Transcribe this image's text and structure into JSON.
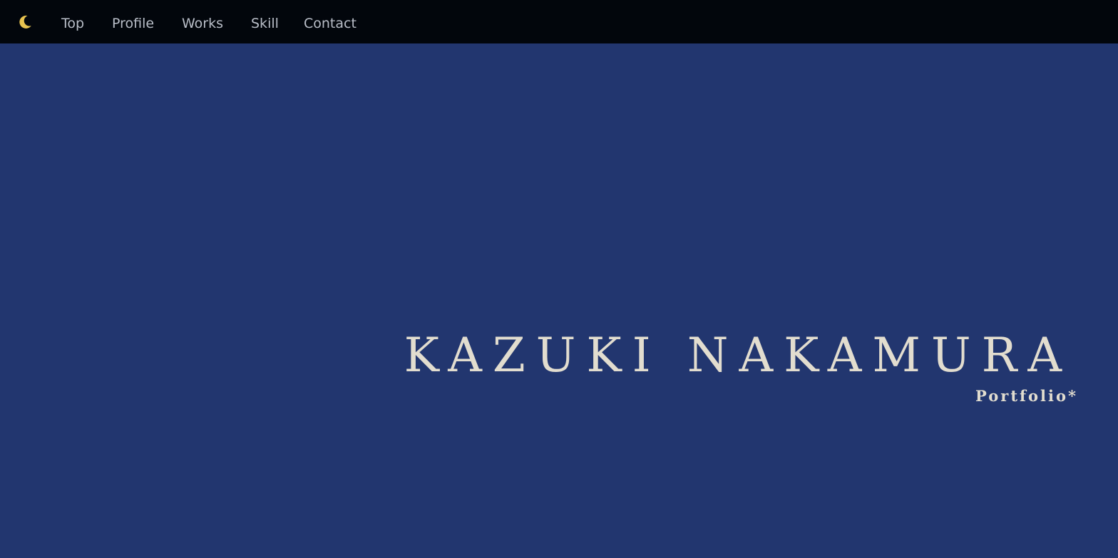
{
  "nav": {
    "theme_icon": "crescent-moon-icon",
    "items": [
      {
        "label": "Top"
      },
      {
        "label": "Profile"
      },
      {
        "label": "Works"
      },
      {
        "label": "Skill"
      },
      {
        "label": "Contact"
      }
    ]
  },
  "hero": {
    "name": "KAZUKI NAKAMURA",
    "subtitle": "Portfolio*"
  },
  "colors": {
    "nav_background": "#02060c",
    "hero_background": "#22366f",
    "nav_text": "#b9bec8",
    "hero_text": "#e2ddcf",
    "moon": "#e8c34f"
  }
}
